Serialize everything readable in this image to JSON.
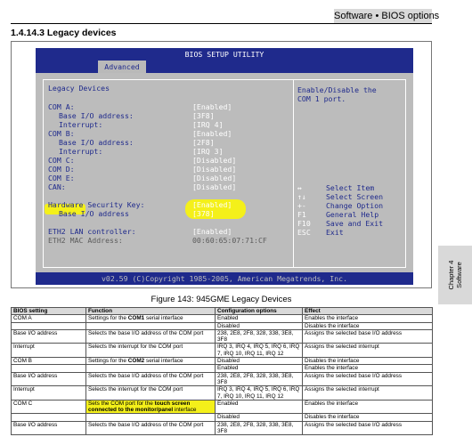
{
  "header": {
    "title": "Software • BIOS options"
  },
  "section": {
    "title": "1.4.14.3 Legacy devices"
  },
  "bios": {
    "title": "BIOS SETUP UTILITY",
    "tab": "Advanced",
    "panel_heading": "Legacy Devices",
    "rows": [
      {
        "label": "COM A:",
        "value": "[Enabled]"
      },
      {
        "label": "Base I/O address:",
        "value": "[3F8]"
      },
      {
        "label": "Interrupt:",
        "value": "[IRQ 4]"
      },
      {
        "label": "COM B:",
        "value": "[Enabled]"
      },
      {
        "label": "Base I/O address:",
        "value": "[2F8]"
      },
      {
        "label": "Interrupt:",
        "value": "[IRQ 3]"
      },
      {
        "label": "COM C:",
        "value": "[Disabled]"
      },
      {
        "label": "COM D:",
        "value": "[Disabled]"
      },
      {
        "label": "COM E:",
        "value": "[Disabled]"
      },
      {
        "label": "CAN:",
        "value": "[Disabled]"
      },
      {
        "label": "Hardware Security Key:",
        "value": "[Enabled]"
      },
      {
        "label": "Base I/O address",
        "value": "[378]"
      },
      {
        "label": "ETH2 LAN controller:",
        "value": "[Enabled]"
      },
      {
        "label": "ETH2 MAC Address:",
        "value": "00:60:65:07:71:CF"
      }
    ],
    "help_line1": "Enable/Disable the",
    "help_line2": "COM 1 port.",
    "keys": [
      {
        "key": "↔",
        "desc": "Select Item"
      },
      {
        "key": "↑↓",
        "desc": "Select Screen"
      },
      {
        "key": "+-",
        "desc": "Change Option"
      },
      {
        "key": "F1",
        "desc": "General Help"
      },
      {
        "key": "F10",
        "desc": "Save and Exit"
      },
      {
        "key": "ESC",
        "desc": "Exit"
      }
    ],
    "footer": "v02.59 (C)Copyright 1985-2005, American Megatrends, Inc."
  },
  "caption": "Figure 143: 945GME Legacy Devices",
  "chapter_tab": {
    "line1": "Chapter 4",
    "line2": "Software"
  },
  "table": {
    "headers": [
      "BIOS setting",
      "Function",
      "Configuration options",
      "Effect"
    ],
    "rows": [
      [
        "COM A",
        "Settings for the COM1 serial interface",
        "Enabled",
        "Enables the interface"
      ],
      [
        "",
        "",
        "Disabled",
        "Disables the interface"
      ],
      [
        "Base I/O address",
        "Selects the base I/O address of the COM port",
        "238, 2E8, 2F8, 328, 338, 3E8, 3F8",
        "Assigns the selected base I/O address"
      ],
      [
        "Interrupt",
        "Selects the interrupt for the COM port",
        "IRQ 3, IRQ 4, IRQ 5, IRQ 6, IRQ 7, IRQ 10, IRQ 11, IRQ 12",
        "Assigns the selected interrupt"
      ],
      [
        "COM B",
        "Settings for the COM2 serial interface",
        "Disabled",
        "Disables the interface"
      ],
      [
        "",
        "",
        "Enabled",
        "Enables the interface"
      ],
      [
        "Base I/O address",
        "Selects the base I/O address of the COM port",
        "238, 2E8, 2F8, 328, 338, 3E8, 3F8",
        "Assigns the selected base I/O address"
      ],
      [
        "Interrupt",
        "Selects the interrupt for the COM port",
        "IRQ 3, IRQ 4, IRQ 5, IRQ 6, IRQ 7, IRQ 10, IRQ 11, IRQ 12",
        "Assigns the selected interrupt"
      ],
      [
        "COM C",
        "Sets the COM port for the touch screen connected to the monitor/panel interface",
        "Enabled",
        "Enables the interface"
      ],
      [
        "",
        "",
        "Disabled",
        "Disables the interface"
      ],
      [
        "Base I/O address",
        "Selects the base I/O address of the COM port",
        "238, 2E8, 2F8, 328, 338, 3E8, 3F8",
        "Assigns the selected base I/O address"
      ]
    ]
  },
  "colors": {
    "bios_blue": "#1f2a8c",
    "bios_gray": "#bcbcbc",
    "highlight": "#f4f01a",
    "header_gray": "#d9d9d9"
  }
}
